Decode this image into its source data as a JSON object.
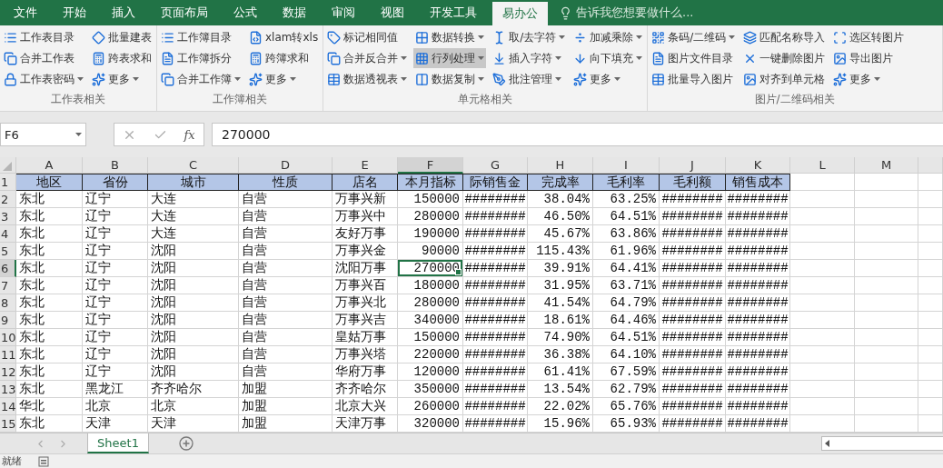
{
  "menu_tabs": [
    {
      "label": "文件",
      "selected": false
    },
    {
      "label": "开始",
      "selected": false
    },
    {
      "label": "插入",
      "selected": false
    },
    {
      "label": "页面布局",
      "selected": false
    },
    {
      "label": "公式",
      "selected": false
    },
    {
      "label": "数据",
      "selected": false
    },
    {
      "label": "审阅",
      "selected": false
    },
    {
      "label": "视图",
      "selected": false
    },
    {
      "label": "开发工具",
      "selected": false
    },
    {
      "label": "易办公",
      "selected": true
    }
  ],
  "tell_me": {
    "placeholder": "告诉我您想要做什么..."
  },
  "ribbon_groups": [
    {
      "label": "工作表相关",
      "columns": [
        [
          {
            "label": "工作表目录",
            "dropdown": false,
            "hovered": false
          },
          {
            "label": "合并工作表",
            "dropdown": false,
            "hovered": false
          },
          {
            "label": "工作表密码",
            "dropdown": true,
            "hovered": false
          }
        ],
        [
          {
            "label": "批量建表",
            "dropdown": false,
            "hovered": false
          },
          {
            "label": "跨表求和",
            "dropdown": false,
            "hovered": false
          },
          {
            "label": "更多",
            "dropdown": true,
            "hovered": false
          }
        ]
      ]
    },
    {
      "label": "工作簿相关",
      "columns": [
        [
          {
            "label": "工作簿目录",
            "dropdown": false,
            "hovered": false
          },
          {
            "label": "工作簿拆分",
            "dropdown": false,
            "hovered": false
          },
          {
            "label": "合并工作簿",
            "dropdown": true,
            "hovered": false
          }
        ],
        [
          {
            "label": "xlam转xls",
            "dropdown": false,
            "hovered": false
          },
          {
            "label": "跨簿求和",
            "dropdown": false,
            "hovered": false
          },
          {
            "label": "更多",
            "dropdown": true,
            "hovered": false
          }
        ]
      ]
    },
    {
      "label": "单元格相关",
      "columns": [
        [
          {
            "label": "标记相同值",
            "dropdown": false,
            "hovered": false
          },
          {
            "label": "合并反合并",
            "dropdown": true,
            "hovered": false
          },
          {
            "label": "数据透视表",
            "dropdown": true,
            "hovered": false
          }
        ],
        [
          {
            "label": "数据转换",
            "dropdown": true,
            "hovered": false
          },
          {
            "label": "行列处理",
            "dropdown": true,
            "hovered": true
          },
          {
            "label": "数据复制",
            "dropdown": true,
            "hovered": false
          }
        ],
        [
          {
            "label": "取/去字符",
            "dropdown": true,
            "hovered": false
          },
          {
            "label": "插入字符",
            "dropdown": true,
            "hovered": false
          },
          {
            "label": "批注管理",
            "dropdown": true,
            "hovered": false
          }
        ],
        [
          {
            "label": "加减乘除",
            "dropdown": true,
            "hovered": false
          },
          {
            "label": "向下填充",
            "dropdown": true,
            "hovered": false
          },
          {
            "label": "更多",
            "dropdown": true,
            "hovered": false
          }
        ]
      ]
    },
    {
      "label": "图片/二维码相关",
      "columns": [
        [
          {
            "label": "条码/二维码",
            "dropdown": true,
            "hovered": false
          },
          {
            "label": "图片文件目录",
            "dropdown": false,
            "hovered": false
          },
          {
            "label": "批量导入图片",
            "dropdown": false,
            "hovered": false
          }
        ],
        [
          {
            "label": "匹配名称导入",
            "dropdown": false,
            "hovered": false
          },
          {
            "label": "一键删除图片",
            "dropdown": false,
            "hovered": false
          },
          {
            "label": "对齐到单元格",
            "dropdown": false,
            "hovered": false
          }
        ],
        [
          {
            "label": "选区转图片",
            "dropdown": false,
            "hovered": false
          },
          {
            "label": "导出图片",
            "dropdown": false,
            "hovered": false
          },
          {
            "label": "更多",
            "dropdown": true,
            "hovered": false
          }
        ]
      ]
    }
  ],
  "formula_bar": {
    "name_box": "F6",
    "function_label": "fx",
    "value": "270000"
  },
  "columns": [
    {
      "letter": "A",
      "selected": false
    },
    {
      "letter": "B",
      "selected": false
    },
    {
      "letter": "C",
      "selected": false
    },
    {
      "letter": "D",
      "selected": false
    },
    {
      "letter": "E",
      "selected": false
    },
    {
      "letter": "F",
      "selected": true
    },
    {
      "letter": "G",
      "selected": false
    },
    {
      "letter": "H",
      "selected": false
    },
    {
      "letter": "I",
      "selected": false
    },
    {
      "letter": "J",
      "selected": false
    },
    {
      "letter": "K",
      "selected": false
    },
    {
      "letter": "L",
      "selected": false
    },
    {
      "letter": "M",
      "selected": false
    }
  ],
  "rows": [
    {
      "number": "1",
      "kind": "header",
      "selected": false,
      "cells": [
        "地区",
        "省份",
        "城市",
        "性质",
        "店名",
        "本月指标",
        "际销售金",
        "完成率",
        "毛利率",
        "毛利额",
        "销售成本"
      ]
    },
    {
      "number": "2",
      "kind": "data",
      "selected": false,
      "cells": [
        "东北",
        "辽宁",
        "大连",
        "自营",
        "万事兴新",
        "150000",
        "########",
        "38.04%",
        "63.25%",
        "########",
        "########"
      ]
    },
    {
      "number": "3",
      "kind": "data",
      "selected": false,
      "cells": [
        "东北",
        "辽宁",
        "大连",
        "自营",
        "万事兴中",
        "280000",
        "########",
        "46.50%",
        "64.51%",
        "########",
        "########"
      ]
    },
    {
      "number": "4",
      "kind": "data",
      "selected": false,
      "cells": [
        "东北",
        "辽宁",
        "大连",
        "自营",
        "友好万事",
        "190000",
        "########",
        "45.67%",
        "63.86%",
        "########",
        "########"
      ]
    },
    {
      "number": "5",
      "kind": "data",
      "selected": false,
      "cells": [
        "东北",
        "辽宁",
        "沈阳",
        "自营",
        "万事兴金",
        "90000",
        "########",
        "115.43%",
        "61.96%",
        "########",
        "########"
      ]
    },
    {
      "number": "6",
      "kind": "data",
      "selected": true,
      "cells": [
        "东北",
        "辽宁",
        "沈阳",
        "自营",
        "沈阳万事",
        "270000",
        "########",
        "39.91%",
        "64.41%",
        "########",
        "########"
      ]
    },
    {
      "number": "7",
      "kind": "data",
      "selected": false,
      "cells": [
        "东北",
        "辽宁",
        "沈阳",
        "自营",
        "万事兴百",
        "180000",
        "########",
        "31.95%",
        "63.71%",
        "########",
        "########"
      ]
    },
    {
      "number": "8",
      "kind": "data",
      "selected": false,
      "cells": [
        "东北",
        "辽宁",
        "沈阳",
        "自营",
        "万事兴北",
        "280000",
        "########",
        "41.54%",
        "64.79%",
        "########",
        "########"
      ]
    },
    {
      "number": "9",
      "kind": "data",
      "selected": false,
      "cells": [
        "东北",
        "辽宁",
        "沈阳",
        "自营",
        "万事兴吉",
        "340000",
        "########",
        "18.61%",
        "64.46%",
        "########",
        "########"
      ]
    },
    {
      "number": "10",
      "kind": "data",
      "selected": false,
      "cells": [
        "东北",
        "辽宁",
        "沈阳",
        "自营",
        "皇姑万事",
        "150000",
        "########",
        "74.90%",
        "64.51%",
        "########",
        "########"
      ]
    },
    {
      "number": "11",
      "kind": "data",
      "selected": false,
      "cells": [
        "东北",
        "辽宁",
        "沈阳",
        "自营",
        "万事兴塔",
        "220000",
        "########",
        "36.38%",
        "64.10%",
        "########",
        "########"
      ]
    },
    {
      "number": "12",
      "kind": "data",
      "selected": false,
      "cells": [
        "东北",
        "辽宁",
        "沈阳",
        "自营",
        "华府万事",
        "120000",
        "########",
        "61.41%",
        "67.59%",
        "########",
        "########"
      ]
    },
    {
      "number": "13",
      "kind": "data",
      "selected": false,
      "cells": [
        "东北",
        "黑龙江",
        "齐齐哈尔",
        "加盟",
        "齐齐哈尔",
        "350000",
        "########",
        "13.54%",
        "62.79%",
        "########",
        "########"
      ]
    },
    {
      "number": "14",
      "kind": "data",
      "selected": false,
      "cells": [
        "华北",
        "北京",
        "北京",
        "加盟",
        "北京大兴",
        "260000",
        "########",
        "22.02%",
        "65.76%",
        "########",
        "########"
      ]
    },
    {
      "number": "15",
      "kind": "data",
      "selected": false,
      "cells": [
        "东北",
        "天津",
        "天津",
        "加盟",
        "天津万事",
        "320000",
        "########",
        "15.96%",
        "65.93%",
        "########",
        "########"
      ]
    }
  ],
  "sheet_tabs": [
    {
      "label": "Sheet1",
      "selected": true
    }
  ],
  "status_bar": {
    "text": "就绪"
  }
}
